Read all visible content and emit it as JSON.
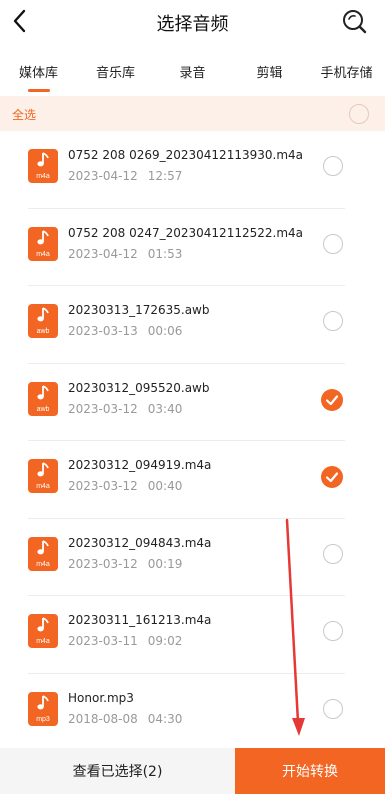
{
  "header": {
    "title": "选择音频",
    "back_icon": "back-arrow-icon",
    "search_icon": "search-icon"
  },
  "tabs": [
    {
      "label": "媒体库",
      "active": true
    },
    {
      "label": "音乐库",
      "active": false
    },
    {
      "label": "录音",
      "active": false
    },
    {
      "label": "剪辑",
      "active": false
    },
    {
      "label": "手机存储",
      "active": false
    }
  ],
  "select_all": {
    "label": "全选",
    "checked": false
  },
  "files": [
    {
      "name": "0752 208 0269_20230412113930.m4a",
      "date": "2023-04-12",
      "duration": "12:57",
      "ext": "m4a",
      "checked": false
    },
    {
      "name": "0752 208 0247_20230412112522.m4a",
      "date": "2023-04-12",
      "duration": "01:53",
      "ext": "m4a",
      "checked": false
    },
    {
      "name": "20230313_172635.awb",
      "date": "2023-03-13",
      "duration": "00:06",
      "ext": "awb",
      "checked": false
    },
    {
      "name": "20230312_095520.awb",
      "date": "2023-03-12",
      "duration": "03:40",
      "ext": "awb",
      "checked": true
    },
    {
      "name": "20230312_094919.m4a",
      "date": "2023-03-12",
      "duration": "00:40",
      "ext": "m4a",
      "checked": true
    },
    {
      "name": "20230312_094843.m4a",
      "date": "2023-03-12",
      "duration": "00:19",
      "ext": "m4a",
      "checked": false
    },
    {
      "name": "20230311_161213.m4a",
      "date": "2023-03-11",
      "duration": "09:02",
      "ext": "m4a",
      "checked": false
    },
    {
      "name": "Honor.mp3",
      "date": "2018-08-08",
      "duration": "04:30",
      "ext": "mp3",
      "checked": false
    }
  ],
  "bottom": {
    "view_selected": "查看已选择(2)",
    "start": "开始转换"
  },
  "colors": {
    "accent": "#f26522",
    "annotation_arrow": "#e53935"
  }
}
